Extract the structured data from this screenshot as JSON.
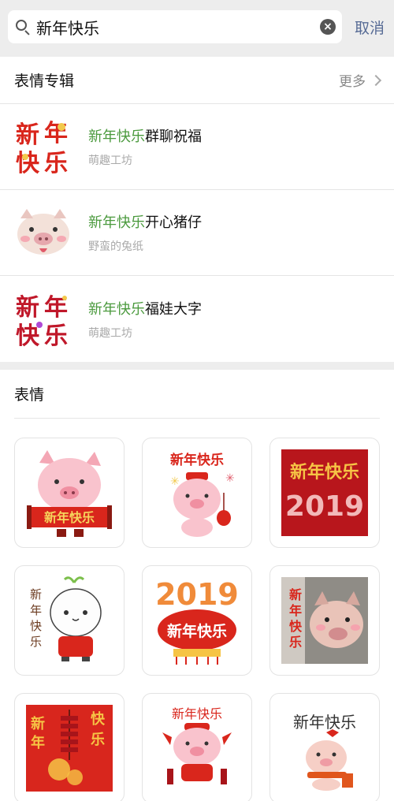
{
  "search": {
    "value": "新年快乐",
    "cancel_label": "取消"
  },
  "albums": {
    "title": "表情专辑",
    "more_label": "更多",
    "items": [
      {
        "highlight": "新年快乐",
        "rest": "群聊祝福",
        "author": "萌趣工坊",
        "icon": "new-year-text-sticker-icon"
      },
      {
        "highlight": "新年快乐",
        "rest": "开心猪仔",
        "author": "野蛮的兔纸",
        "icon": "pig-face-sticker-icon"
      },
      {
        "highlight": "新年快乐",
        "rest": "福娃大字",
        "author": "萌趣工坊",
        "icon": "new-year-bigtext-sticker-icon"
      }
    ]
  },
  "emoji": {
    "title": "表情",
    "stickers": [
      {
        "icon": "pig-holding-banner-sticker",
        "text": "新年快乐"
      },
      {
        "icon": "pig-with-lantern-sticker",
        "text": "新年快乐"
      },
      {
        "icon": "new-year-2019-card-sticker",
        "text": "新年快乐",
        "year": "2019"
      },
      {
        "icon": "bun-character-sticker",
        "text": "新年快乐"
      },
      {
        "icon": "2019-lantern-sticker",
        "text": "新年快乐",
        "year": "2019"
      },
      {
        "icon": "real-piglet-photo-sticker",
        "text": "新年快乐"
      },
      {
        "icon": "firecracker-sticker",
        "text": "新年快乐"
      },
      {
        "icon": "pig-with-firecrackers-sticker",
        "text": "新年快乐"
      },
      {
        "icon": "pig-with-scarf-sticker",
        "text": "新年快乐"
      }
    ]
  }
}
